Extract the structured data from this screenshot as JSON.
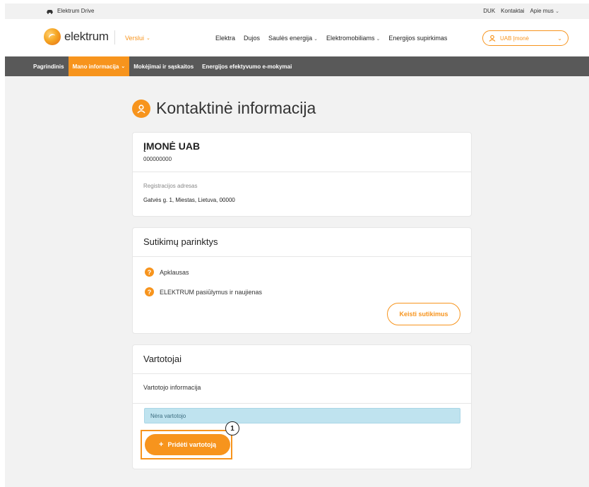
{
  "topbar": {
    "brand_label": "Elektrum Drive",
    "links": [
      "DUK",
      "Kontaktai"
    ],
    "about_label": "Apie mus"
  },
  "header": {
    "logo_text": "elektrum",
    "segment_label": "Verslui",
    "nav": [
      {
        "label": "Elektra",
        "dropdown": false
      },
      {
        "label": "Dujos",
        "dropdown": false
      },
      {
        "label": "Saulės energija",
        "dropdown": true
      },
      {
        "label": "Elektromobiliams",
        "dropdown": true
      },
      {
        "label": "Energijos supirkimas",
        "dropdown": false
      }
    ],
    "account_label": "UAB Įmonė"
  },
  "subnav": {
    "items": [
      {
        "label": "Pagrindinis",
        "active": false
      },
      {
        "label": "Mano informacija",
        "active": true
      },
      {
        "label": "Mokėjimai ir sąskaitos",
        "active": false
      },
      {
        "label": "Energijos efektyvumo e-mokymai",
        "active": false
      }
    ]
  },
  "page": {
    "title": "Kontaktinė informacija"
  },
  "company": {
    "name": "ĮMONĖ UAB",
    "code": "000000000",
    "address_label": "Registracijos adresas",
    "address_value": "Gatvės g. 1, Miestas, Lietuva, 00000"
  },
  "consents": {
    "heading": "Sutikimų parinktys",
    "items": [
      "Apklausas",
      "ELEKTRUM pasiūlymus ir naujienas"
    ],
    "change_button": "Keisti sutikimus"
  },
  "users": {
    "heading": "Vartotojai",
    "info_label": "Vartotojo informacija",
    "empty_message": "Nėra vartotojo",
    "add_button": "Pridėti vartotoją",
    "step_badge": "1"
  },
  "colors": {
    "accent": "#f7941d",
    "subnav_bg": "#595959",
    "content_bg": "#f2f2f2",
    "info_bg": "#bfe3ef"
  },
  "icons": {
    "brand": "car-icon",
    "dropdown": "chevron-down-icon",
    "account": "user-icon",
    "title": "user-icon",
    "consent": "question-icon",
    "add": "plus-icon"
  }
}
